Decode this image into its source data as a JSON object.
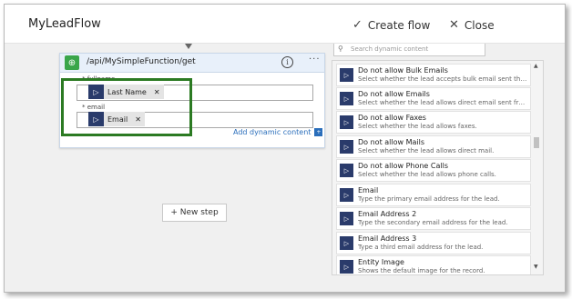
{
  "app": {
    "title": "MyLeadFlow"
  },
  "toolbar": {
    "create_flow_label": "Create flow",
    "close_label": "Close",
    "create_icon": "checkmark-icon",
    "close_icon": "close-icon"
  },
  "card": {
    "title": "/api/MySimpleFunction/get",
    "fields": [
      {
        "label": "* fullname",
        "token": "Last Name"
      },
      {
        "label": "* email",
        "token": "Email"
      }
    ],
    "add_dynamic_label": "Add dynamic content"
  },
  "new_step_label": "+ New step",
  "dynamic_panel": {
    "search_placeholder": "Search dynamic content",
    "items": [
      {
        "name": "Do not allow Bulk Emails",
        "desc": "Select whether the lead accepts bulk email sent thro..."
      },
      {
        "name": "Do not allow Emails",
        "desc": "Select whether the lead allows direct email sent fro..."
      },
      {
        "name": "Do not allow Faxes",
        "desc": "Select whether the lead allows faxes."
      },
      {
        "name": "Do not allow Mails",
        "desc": "Select whether the lead allows direct mail."
      },
      {
        "name": "Do not allow Phone Calls",
        "desc": "Select whether the lead allows phone calls."
      },
      {
        "name": "Email",
        "desc": "Type the primary email address for the lead."
      },
      {
        "name": "Email Address 2",
        "desc": "Type the secondary email address for the lead."
      },
      {
        "name": "Email Address 3",
        "desc": "Type a third email address for the lead."
      },
      {
        "name": "Entity Image",
        "desc": "Shows the default image for the record."
      }
    ]
  },
  "colors": {
    "highlight": "#2b7a22",
    "accent": "#2a6ebb",
    "dynamics_icon": "#2a3b6b",
    "action_icon": "#3aa64a"
  }
}
